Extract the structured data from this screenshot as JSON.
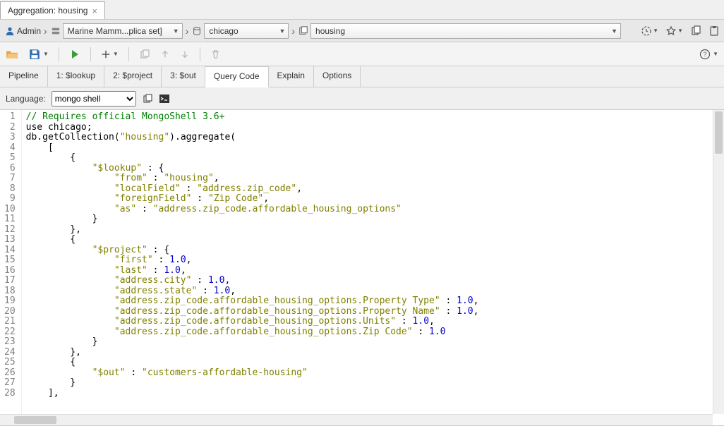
{
  "tab": {
    "title": "Aggregation: housing"
  },
  "breadcrumb": {
    "user": "Admin",
    "server": "Marine Mamm...plica set]",
    "database": "chicago",
    "collection": "housing"
  },
  "toolbar": {},
  "stage_tabs": [
    "Pipeline",
    "1: $lookup",
    "2: $project",
    "3: $out",
    "Query Code",
    "Explain",
    "Options"
  ],
  "active_stage_tab": 4,
  "language_bar": {
    "label": "Language:",
    "selected": "mongo shell"
  },
  "code": {
    "lines": [
      {
        "n": 1,
        "segs": [
          {
            "t": "// Requires official MongoShell 3.6+",
            "c": "c-comment"
          }
        ]
      },
      {
        "n": 2,
        "segs": [
          {
            "t": "use chicago;",
            "c": "c-key"
          }
        ]
      },
      {
        "n": 3,
        "segs": [
          {
            "t": "db.getCollection(",
            "c": "c-key"
          },
          {
            "t": "\"housing\"",
            "c": "c-string"
          },
          {
            "t": ").aggregate(",
            "c": "c-key"
          }
        ]
      },
      {
        "n": 4,
        "segs": [
          {
            "t": "    [",
            "c": "c-key"
          }
        ]
      },
      {
        "n": 5,
        "segs": [
          {
            "t": "        { ",
            "c": "c-key"
          }
        ]
      },
      {
        "n": 6,
        "segs": [
          {
            "t": "            ",
            "c": ""
          },
          {
            "t": "\"$lookup\"",
            "c": "c-string"
          },
          {
            "t": " : { ",
            "c": "c-key"
          }
        ]
      },
      {
        "n": 7,
        "segs": [
          {
            "t": "                ",
            "c": ""
          },
          {
            "t": "\"from\"",
            "c": "c-string"
          },
          {
            "t": " : ",
            "c": "c-key"
          },
          {
            "t": "\"housing\"",
            "c": "c-string"
          },
          {
            "t": ", ",
            "c": "c-key"
          }
        ]
      },
      {
        "n": 8,
        "segs": [
          {
            "t": "                ",
            "c": ""
          },
          {
            "t": "\"localField\"",
            "c": "c-string"
          },
          {
            "t": " : ",
            "c": "c-key"
          },
          {
            "t": "\"address.zip_code\"",
            "c": "c-string"
          },
          {
            "t": ", ",
            "c": "c-key"
          }
        ]
      },
      {
        "n": 9,
        "segs": [
          {
            "t": "                ",
            "c": ""
          },
          {
            "t": "\"foreignField\"",
            "c": "c-string"
          },
          {
            "t": " : ",
            "c": "c-key"
          },
          {
            "t": "\"Zip Code\"",
            "c": "c-string"
          },
          {
            "t": ", ",
            "c": "c-key"
          }
        ]
      },
      {
        "n": 10,
        "segs": [
          {
            "t": "                ",
            "c": ""
          },
          {
            "t": "\"as\"",
            "c": "c-string"
          },
          {
            "t": " : ",
            "c": "c-key"
          },
          {
            "t": "\"address.zip_code.affordable_housing_options\"",
            "c": "c-string"
          }
        ]
      },
      {
        "n": 11,
        "segs": [
          {
            "t": "            }",
            "c": "c-key"
          }
        ]
      },
      {
        "n": 12,
        "segs": [
          {
            "t": "        }, ",
            "c": "c-key"
          }
        ]
      },
      {
        "n": 13,
        "segs": [
          {
            "t": "        { ",
            "c": "c-key"
          }
        ]
      },
      {
        "n": 14,
        "segs": [
          {
            "t": "            ",
            "c": ""
          },
          {
            "t": "\"$project\"",
            "c": "c-string"
          },
          {
            "t": " : { ",
            "c": "c-key"
          }
        ]
      },
      {
        "n": 15,
        "segs": [
          {
            "t": "                ",
            "c": ""
          },
          {
            "t": "\"first\"",
            "c": "c-string"
          },
          {
            "t": " : ",
            "c": "c-key"
          },
          {
            "t": "1.0",
            "c": "c-num"
          },
          {
            "t": ", ",
            "c": "c-key"
          }
        ]
      },
      {
        "n": 16,
        "segs": [
          {
            "t": "                ",
            "c": ""
          },
          {
            "t": "\"last\"",
            "c": "c-string"
          },
          {
            "t": " : ",
            "c": "c-key"
          },
          {
            "t": "1.0",
            "c": "c-num"
          },
          {
            "t": ", ",
            "c": "c-key"
          }
        ]
      },
      {
        "n": 17,
        "segs": [
          {
            "t": "                ",
            "c": ""
          },
          {
            "t": "\"address.city\"",
            "c": "c-string"
          },
          {
            "t": " : ",
            "c": "c-key"
          },
          {
            "t": "1.0",
            "c": "c-num"
          },
          {
            "t": ", ",
            "c": "c-key"
          }
        ]
      },
      {
        "n": 18,
        "segs": [
          {
            "t": "                ",
            "c": ""
          },
          {
            "t": "\"address.state\"",
            "c": "c-string"
          },
          {
            "t": " : ",
            "c": "c-key"
          },
          {
            "t": "1.0",
            "c": "c-num"
          },
          {
            "t": ", ",
            "c": "c-key"
          }
        ]
      },
      {
        "n": 19,
        "segs": [
          {
            "t": "                ",
            "c": ""
          },
          {
            "t": "\"address.zip_code.affordable_housing_options.Property Type\"",
            "c": "c-string"
          },
          {
            "t": " : ",
            "c": "c-key"
          },
          {
            "t": "1.0",
            "c": "c-num"
          },
          {
            "t": ", ",
            "c": "c-key"
          }
        ]
      },
      {
        "n": 20,
        "segs": [
          {
            "t": "                ",
            "c": ""
          },
          {
            "t": "\"address.zip_code.affordable_housing_options.Property Name\"",
            "c": "c-string"
          },
          {
            "t": " : ",
            "c": "c-key"
          },
          {
            "t": "1.0",
            "c": "c-num"
          },
          {
            "t": ", ",
            "c": "c-key"
          }
        ]
      },
      {
        "n": 21,
        "segs": [
          {
            "t": "                ",
            "c": ""
          },
          {
            "t": "\"address.zip_code.affordable_housing_options.Units\"",
            "c": "c-string"
          },
          {
            "t": " : ",
            "c": "c-key"
          },
          {
            "t": "1.0",
            "c": "c-num"
          },
          {
            "t": ", ",
            "c": "c-key"
          }
        ]
      },
      {
        "n": 22,
        "segs": [
          {
            "t": "                ",
            "c": ""
          },
          {
            "t": "\"address.zip_code.affordable_housing_options.Zip Code\"",
            "c": "c-string"
          },
          {
            "t": " : ",
            "c": "c-key"
          },
          {
            "t": "1.0",
            "c": "c-num"
          }
        ]
      },
      {
        "n": 23,
        "segs": [
          {
            "t": "            }",
            "c": "c-key"
          }
        ]
      },
      {
        "n": 24,
        "segs": [
          {
            "t": "        }, ",
            "c": "c-key"
          }
        ]
      },
      {
        "n": 25,
        "segs": [
          {
            "t": "        { ",
            "c": "c-key"
          }
        ]
      },
      {
        "n": 26,
        "segs": [
          {
            "t": "            ",
            "c": ""
          },
          {
            "t": "\"$out\"",
            "c": "c-string"
          },
          {
            "t": " : ",
            "c": "c-key"
          },
          {
            "t": "\"customers-affordable-housing\"",
            "c": "c-string"
          }
        ]
      },
      {
        "n": 27,
        "segs": [
          {
            "t": "        }",
            "c": "c-key"
          }
        ]
      },
      {
        "n": 28,
        "segs": [
          {
            "t": "    ], ",
            "c": "c-key"
          }
        ]
      }
    ]
  }
}
